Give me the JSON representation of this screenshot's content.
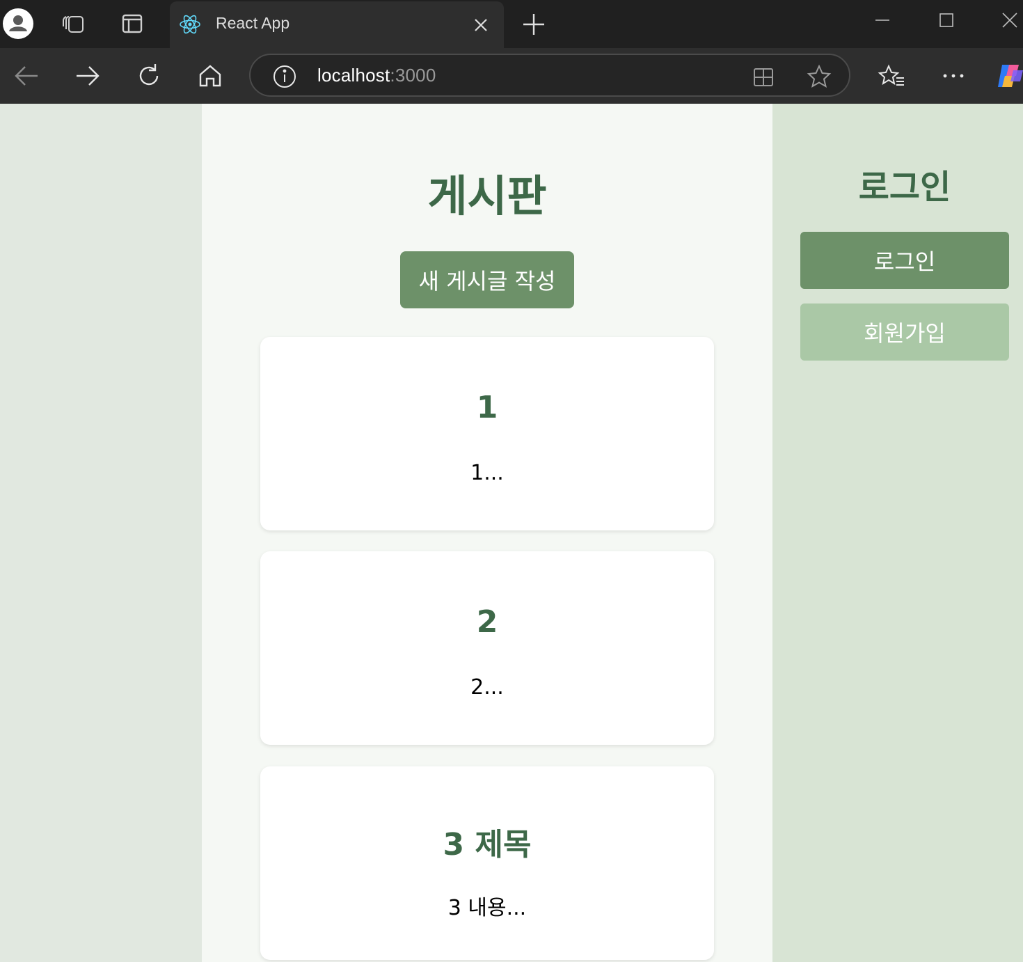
{
  "browser": {
    "tab_title": "React App",
    "url_host": "localhost",
    "url_port": ":3000"
  },
  "board": {
    "title": "게시판",
    "new_post_label": "새 게시글 작성",
    "posts": [
      {
        "title": "1",
        "excerpt": "1..."
      },
      {
        "title": "2",
        "excerpt": "2..."
      },
      {
        "title": "3 제목",
        "excerpt": "3 내용..."
      }
    ]
  },
  "auth": {
    "title": "로그인",
    "login_label": "로그인",
    "signup_label": "회원가입"
  },
  "colors": {
    "accent": "#6d9169",
    "accent_light": "#aac8a6",
    "heading": "#3d6848"
  }
}
